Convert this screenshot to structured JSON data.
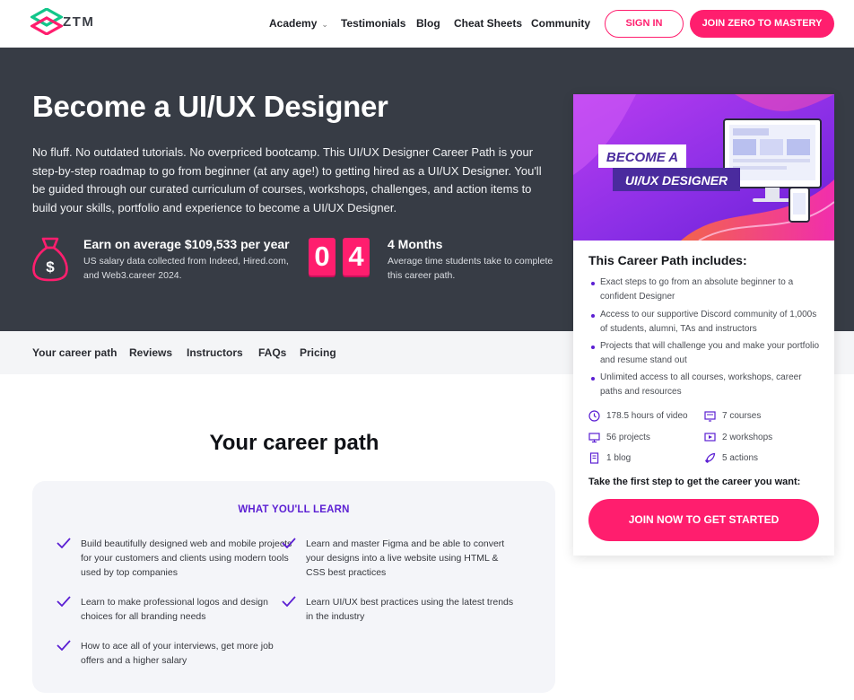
{
  "brand": {
    "name": "ZTM",
    "accent": "#ff1e6e",
    "purple": "#5b1fd3",
    "hero_bg": "#373c45"
  },
  "nav": {
    "items": [
      {
        "label": "Academy",
        "has_dropdown": true
      },
      {
        "label": "Testimonials"
      },
      {
        "label": "Blog"
      },
      {
        "label": "Cheat Sheets"
      },
      {
        "label": "Community"
      }
    ],
    "signin_label": "SIGN IN",
    "join_label": "JOIN ZERO TO MASTERY"
  },
  "hero": {
    "title": "Become a UI/UX Designer",
    "description": "No fluff. No outdated tutorials. No overpriced bootcamp. This UI/UX Designer Career Path is your step-by-step roadmap to go from beginner (at any age!) to getting hired as a UI/UX Designer. You'll be guided through our curated curriculum of courses, workshops, challenges, and action items to build your skills, portfolio and experience to become a UI/UX Designer.",
    "salary": {
      "title": "Earn on average $109,533 per year",
      "subtitle": "US salary data collected from Indeed, Hired.com, and Web3.career 2024."
    },
    "duration": {
      "digits": [
        "0",
        "4"
      ],
      "title": "4 Months",
      "subtitle": "Average time students take to complete this career path."
    }
  },
  "subnav": {
    "items": [
      "Your career path",
      "Reviews",
      "Instructors",
      "FAQs",
      "Pricing"
    ]
  },
  "career": {
    "title": "Your career path",
    "learn_heading": "WHAT YOU'LL LEARN",
    "items": [
      "Build beautifully designed web and mobile projects for your customers and clients using modern tools used by top companies",
      "Learn and master Figma and be able to convert your designs into a live website using HTML & CSS best practices",
      "Learn to make professional logos and design choices for all branding needs",
      "Learn UI/UX best practices using the latest trends in the industry",
      "How to ace all of your interviews, get more job offers and a higher salary"
    ]
  },
  "card": {
    "banner": {
      "line1": "BECOME A",
      "line2": "UI/UX DESIGNER"
    },
    "title": "This Career Path includes:",
    "includes": [
      "Exact steps to go from an absolute beginner to a confident Designer",
      "Access to our supportive Discord community of 1,000s of students, alumni, TAs and instructors",
      "Projects that will challenge you and make your portfolio and resume stand out",
      "Unlimited access to all courses, workshops, career paths and resources"
    ],
    "stats": [
      {
        "icon": "clock-icon",
        "label": "178.5 hours of video"
      },
      {
        "icon": "course-icon",
        "label": "7 courses"
      },
      {
        "icon": "monitor-icon",
        "label": "56 projects"
      },
      {
        "icon": "workshop-icon",
        "label": "2 workshops"
      },
      {
        "icon": "document-icon",
        "label": "1 blog"
      },
      {
        "icon": "rocket-icon",
        "label": "5 actions"
      }
    ],
    "first_step": "Take the first step to get the career you want:",
    "cta_label": "JOIN NOW TO GET STARTED"
  }
}
